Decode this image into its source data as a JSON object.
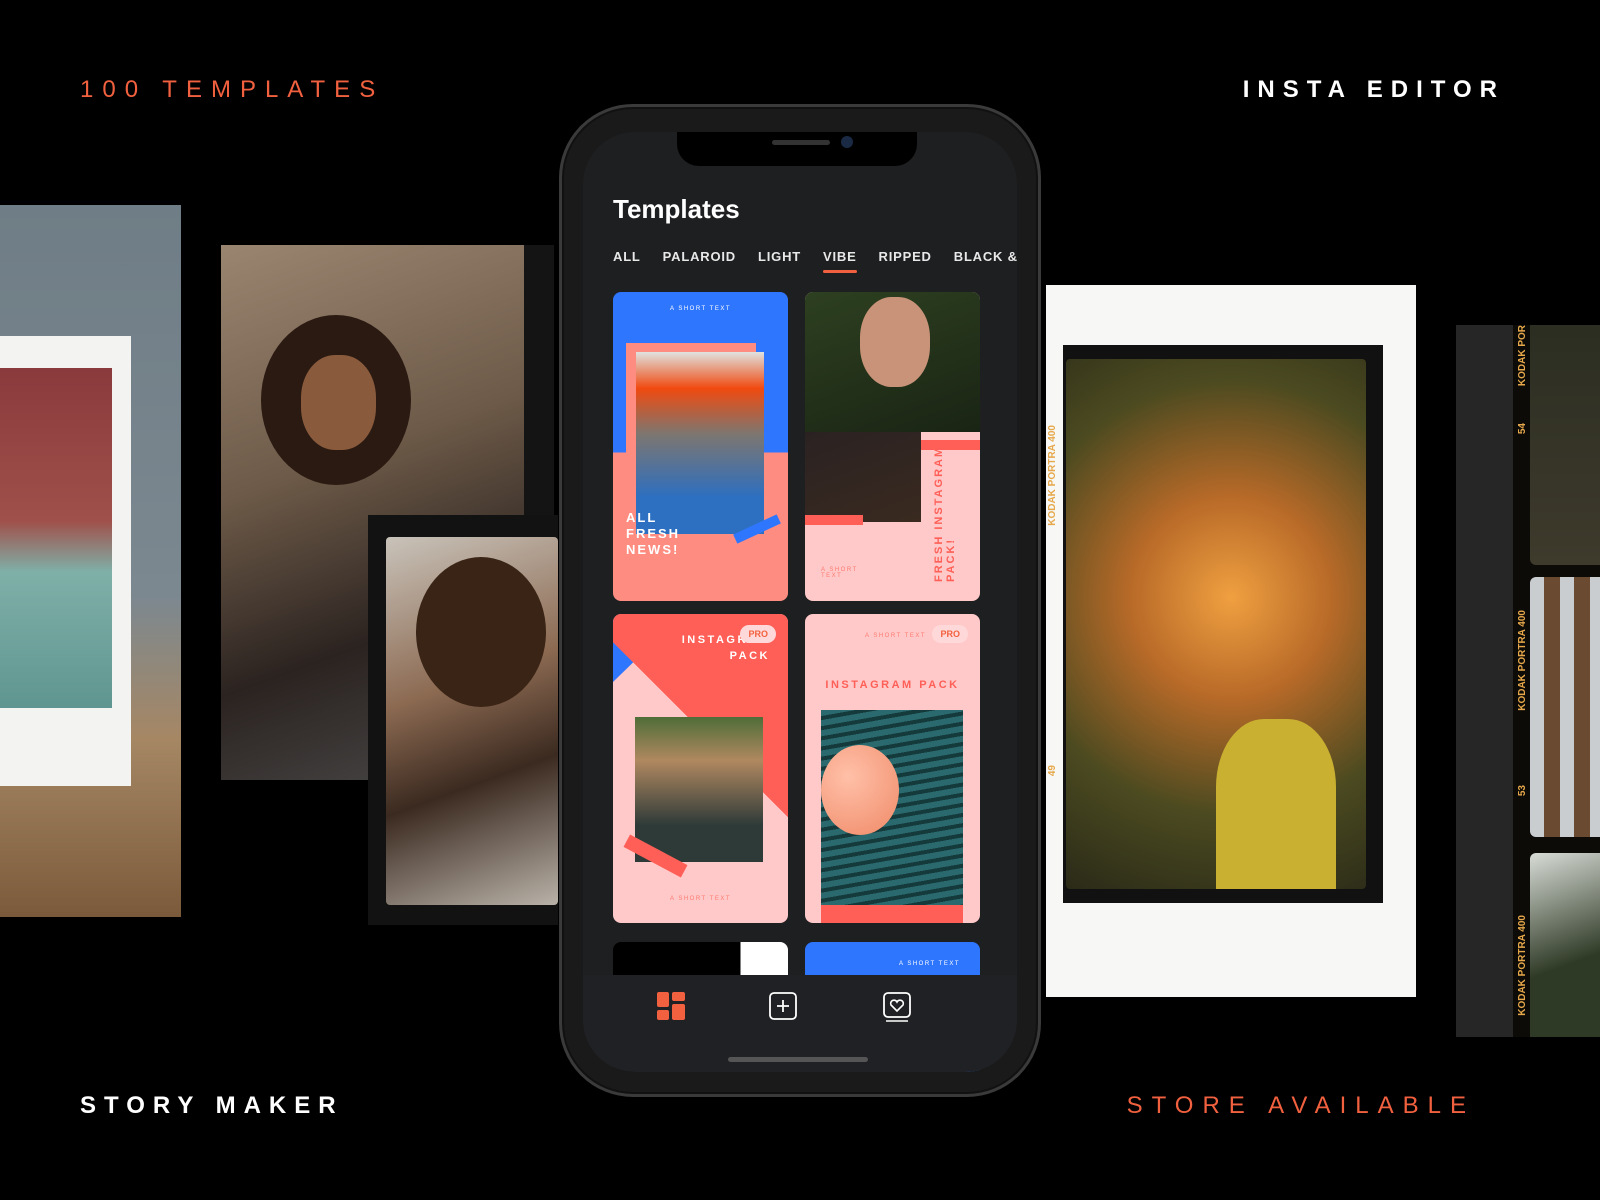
{
  "captions": {
    "top_left": "100 TEMPLATES",
    "top_right": "INSTA EDITOR",
    "bottom_left": "STORY MAKER",
    "bottom_right": "STORE AVAILABLE"
  },
  "colors": {
    "accent": "#f2613f",
    "blue": "#2f76ff",
    "pink": "#ffc9c9",
    "coral": "#ff5f57",
    "screen_bg": "#1e1f21"
  },
  "film": {
    "strip1": [
      "KODAK POR",
      "54",
      "KODAK PORTRA 400",
      "53",
      "KODAK PORTRA 400"
    ],
    "polaroid": [
      "KODAK PORTRA 400",
      "49"
    ]
  },
  "app": {
    "title": "Templates",
    "tabs": [
      {
        "label": "ALL"
      },
      {
        "label": "PALAROID"
      },
      {
        "label": "LIGHT"
      },
      {
        "label": "VIBE",
        "active": true
      },
      {
        "label": "RIPPED"
      },
      {
        "label": "BLACK & WHITE"
      }
    ],
    "cards": [
      {
        "top_text": "A SHORT TEXT",
        "headline": "ALL FRESH NEWS!"
      },
      {
        "small_text": "A SHORT TEXT",
        "headline": "FRESH INSTAGRAM PACK!"
      },
      {
        "headline": "INSTAGRAM PACK",
        "badge": "PRO",
        "bottom_text": "A SHORT TEXT"
      },
      {
        "top_text": "A SHORT TEXT",
        "headline": "INSTAGRAM PACK",
        "badge": "PRO"
      },
      {},
      {
        "top_text": "A SHORT TEXT"
      }
    ],
    "nav": [
      {
        "icon": "templates-grid-icon",
        "active": true
      },
      {
        "icon": "add-square-icon"
      },
      {
        "icon": "favorites-heart-icon"
      }
    ]
  }
}
